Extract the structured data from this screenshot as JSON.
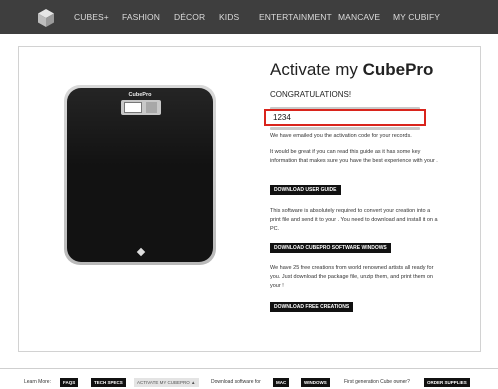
{
  "nav": {
    "logo_icon": "cube-logo-icon",
    "items": [
      "CUBES+",
      "FASHION",
      "DÉCOR",
      "KIDS",
      "ENTERTAINMENT",
      "MANCAVE",
      "MY CUBIFY"
    ]
  },
  "printer": {
    "brand": "CubePro"
  },
  "main": {
    "title_prefix": "Activate my ",
    "title_product": "CubePro",
    "congrats": "CONGRATULATIONS!",
    "code_value": "1234",
    "emailed_text": "We have emailed you the activation code for your records.",
    "guide_text": "It would be great if you can read this guide as it has some key information that makes sure you have the best experience with your .",
    "download_guide_label": "DOWNLOAD USER GUIDE",
    "software_text": "This software is absolutely required to convert your creation into a print file and send it to your . You need to download and install it on a PC.",
    "download_software_label": "DOWNLOAD CUBEPRO SOFTWARE WINDOWS",
    "creations_text": "We have 25 free creations from world renowned artists all ready for you. Just download the package file, unzip them, and print them on your !",
    "download_creations_label": "DOWNLOAD FREE CREATIONS"
  },
  "footer": {
    "learn_more": "Learn More:",
    "faqs": "FAQS",
    "tech_specs": "TECH SPECS",
    "activate": "ACTIVATE MY CUBEPRO",
    "activate_arrow": "▲",
    "download_for": "Download software for",
    "mac": "MAC",
    "windows": "WINDOWS",
    "first_gen": "First generation Cube owner?",
    "order_supplies": "ORDER SUPPLIES"
  },
  "colors": {
    "nav_bg": "#3e3e3e",
    "highlight_border": "#d9241c",
    "button_bg": "#111111"
  }
}
